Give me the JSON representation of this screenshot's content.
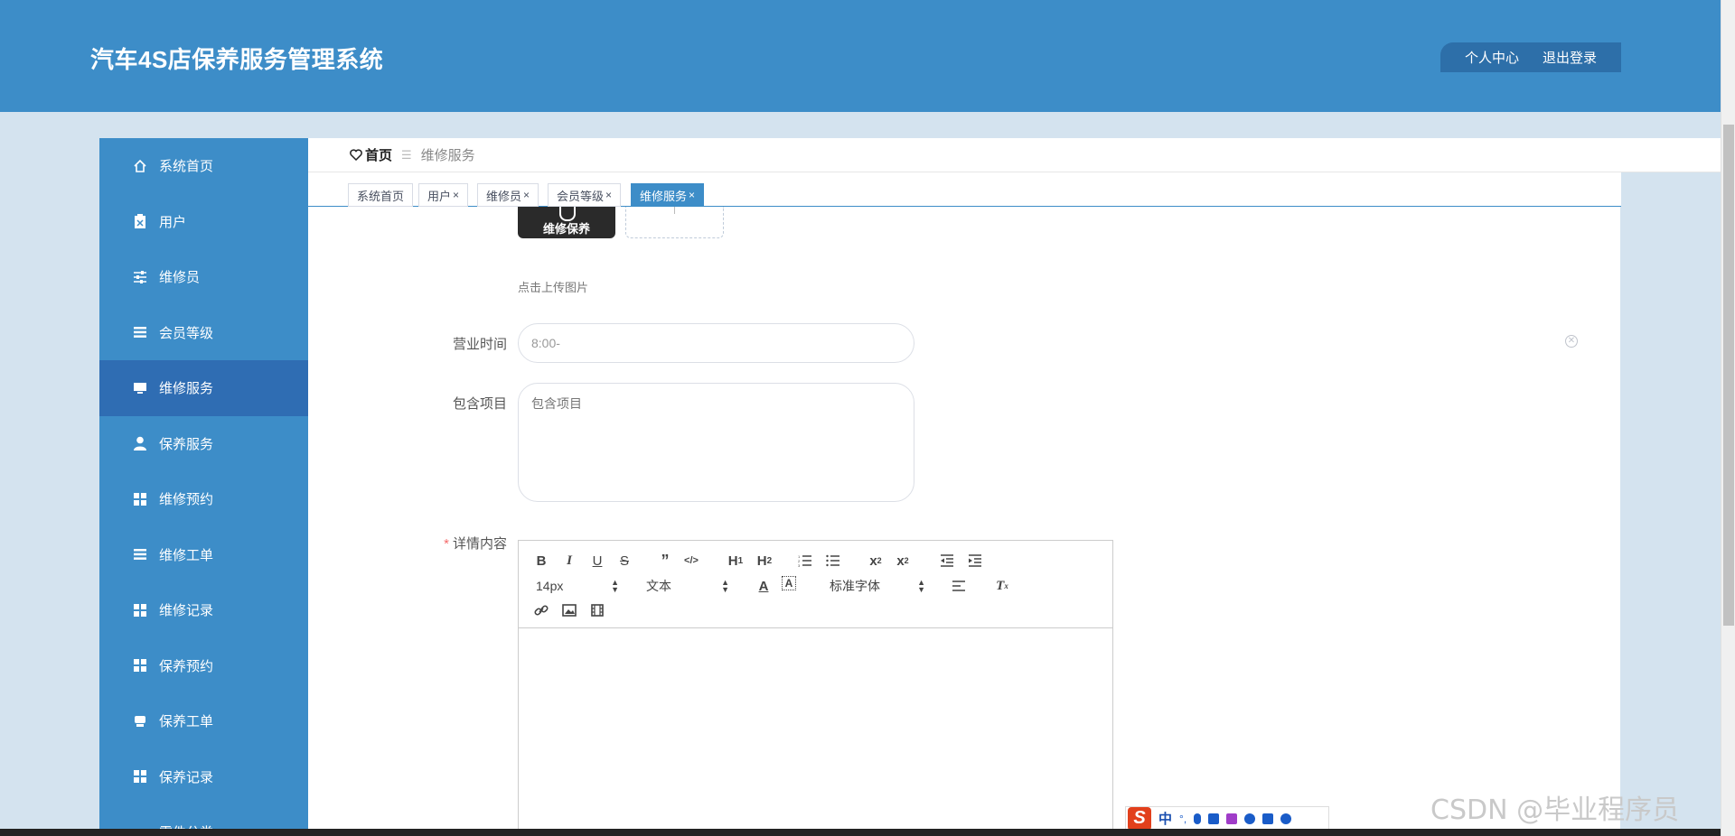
{
  "header": {
    "title": "汽车4S店保养服务管理系统",
    "user_center": "个人中心",
    "logout": "退出登录"
  },
  "sidebar": {
    "items": [
      {
        "label": "系统首页",
        "icon": "home-icon"
      },
      {
        "label": "用户",
        "icon": "clipboard-icon"
      },
      {
        "label": "维修员",
        "icon": "sliders-icon"
      },
      {
        "label": "会员等级",
        "icon": "list-icon"
      },
      {
        "label": "维修服务",
        "icon": "monitor-icon",
        "active": true
      },
      {
        "label": "保养服务",
        "icon": "user-icon"
      },
      {
        "label": "维修预约",
        "icon": "grid-icon"
      },
      {
        "label": "维修工单",
        "icon": "list-icon"
      },
      {
        "label": "维修记录",
        "icon": "grid-icon"
      },
      {
        "label": "保养预约",
        "icon": "grid-icon"
      },
      {
        "label": "保养工单",
        "icon": "print-icon"
      },
      {
        "label": "保养记录",
        "icon": "grid-icon"
      },
      {
        "label": "零件分类",
        "icon": "chart-icon"
      }
    ]
  },
  "breadcrumb": {
    "home": "首页",
    "current": "维修服务"
  },
  "tabs": [
    {
      "label": "系统首页",
      "closable": false
    },
    {
      "label": "用户",
      "closable": true
    },
    {
      "label": "维修员",
      "closable": true
    },
    {
      "label": "会员等级",
      "closable": true
    },
    {
      "label": "维修服务",
      "closable": true,
      "active": true
    }
  ],
  "tab_close": "×",
  "form": {
    "image_caption": "维修保养",
    "upload_hint": "点击上传图片",
    "hours_label": "营业时间",
    "hours_value": "8:00-",
    "items_label": "包含项目",
    "items_placeholder": "包含项目",
    "detail_required_mark": "*",
    "detail_label": "详情内容"
  },
  "editor": {
    "font_size": "14px",
    "header_select": "文本",
    "font_family": "标准字体",
    "buttons": [
      "bold",
      "italic",
      "underline",
      "strike",
      "blockquote",
      "code-block",
      "h1",
      "h2",
      "ordered-list",
      "bullet-list",
      "subscript",
      "superscript",
      "outdent",
      "indent",
      "color",
      "background",
      "align",
      "clean",
      "link",
      "image",
      "video"
    ]
  },
  "ime": {
    "logo": "S",
    "mode": "中"
  },
  "watermark": "CSDN @毕业程序员"
}
